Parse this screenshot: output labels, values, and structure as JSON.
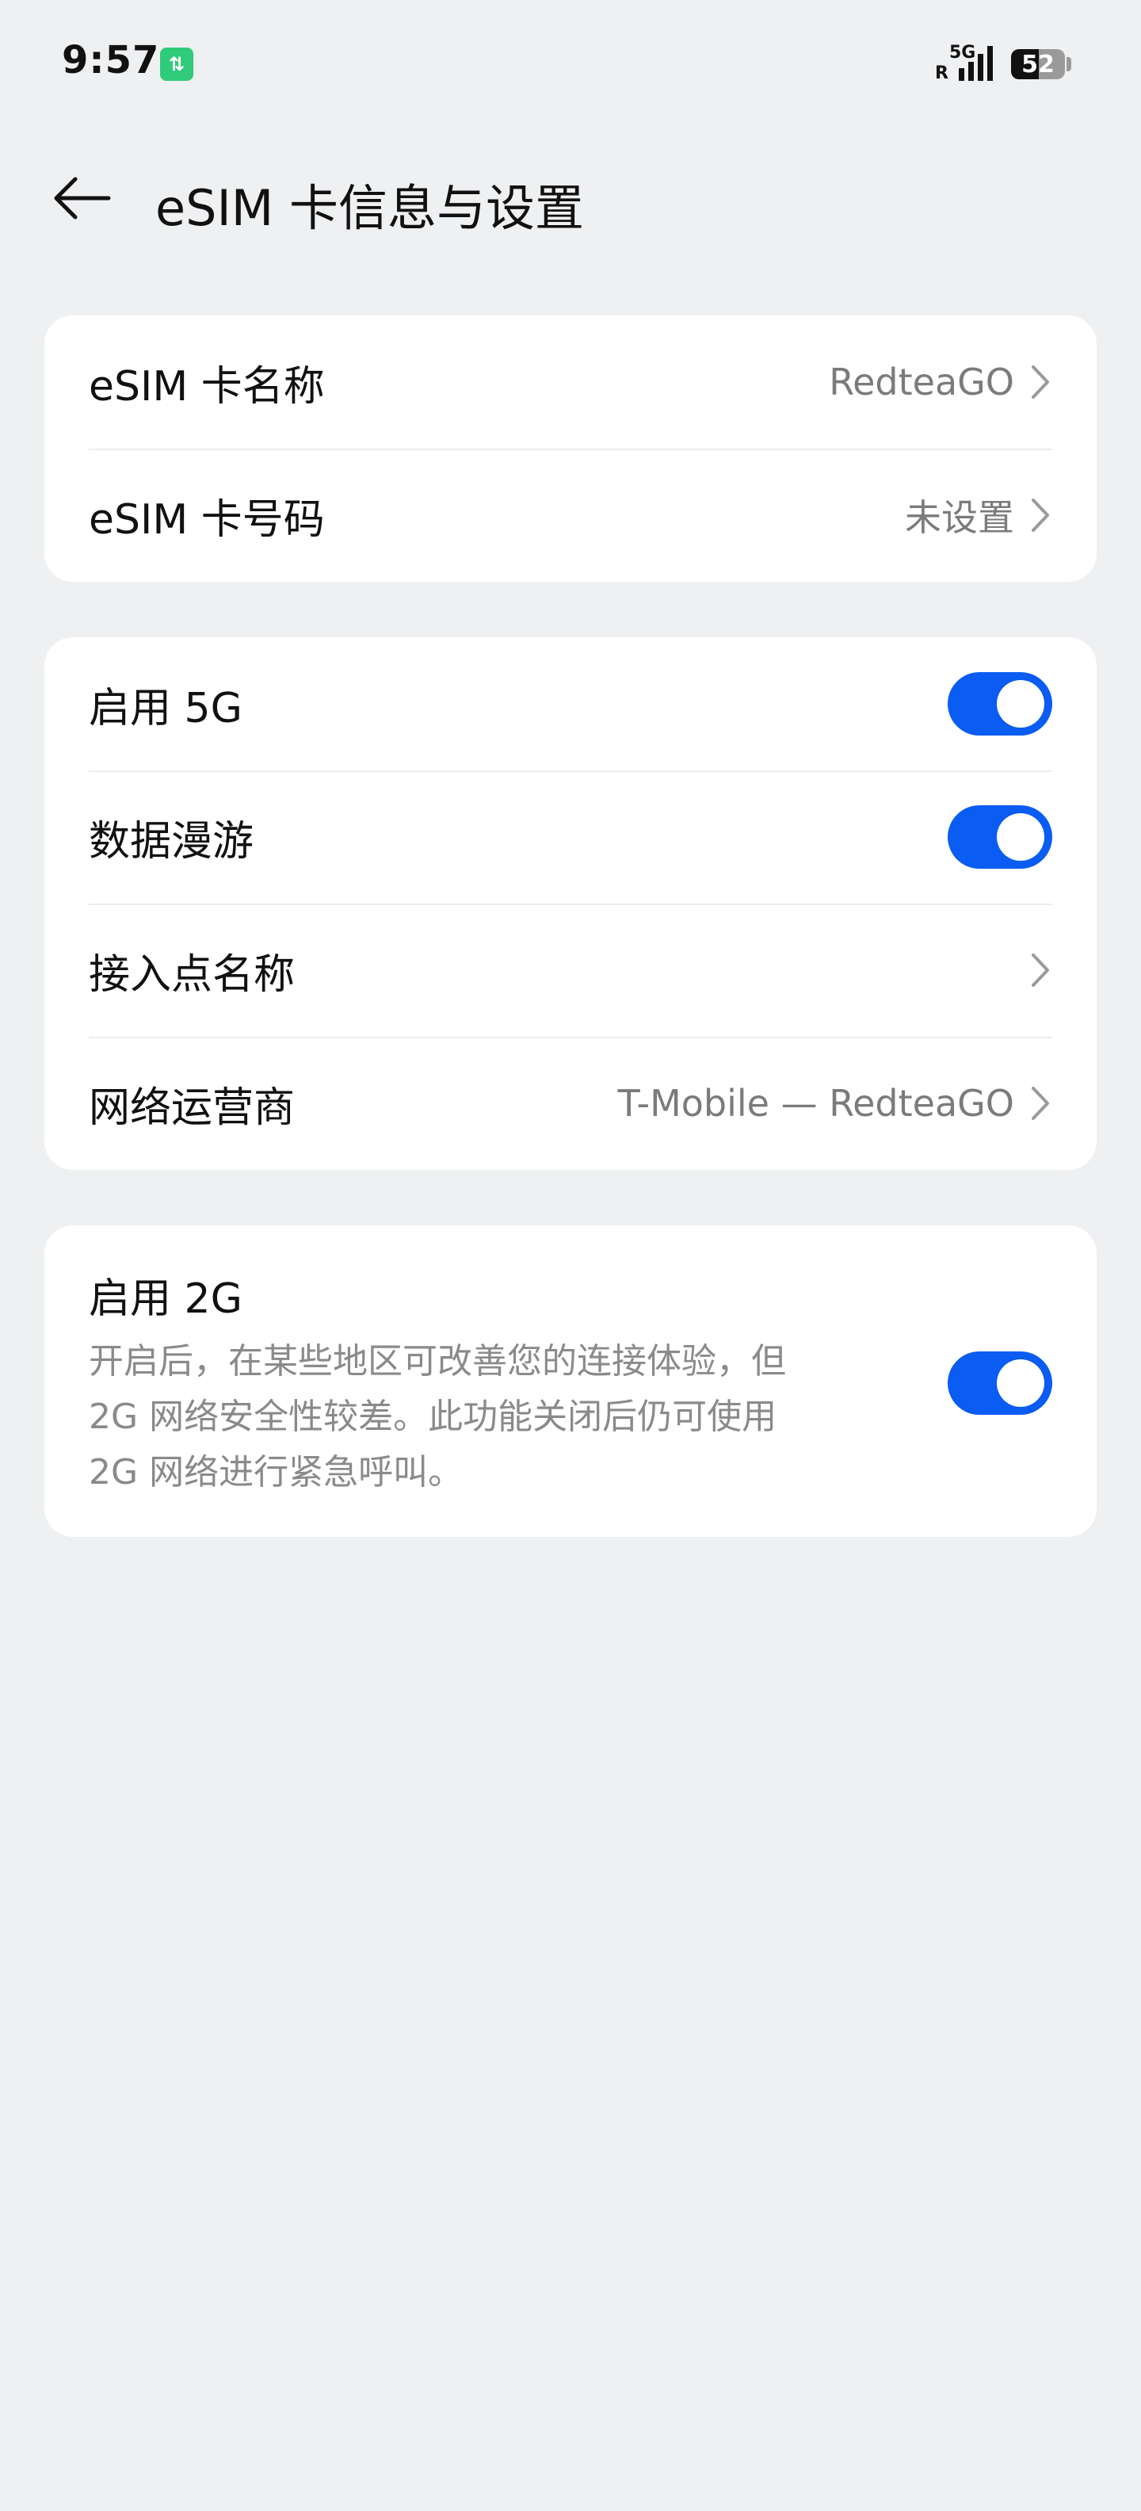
{
  "status_bar": {
    "time": "9:57",
    "data_badge": "⇅",
    "network_type": "5G",
    "roaming": "R",
    "battery_level": "52",
    "battery_fraction": 0.52
  },
  "header": {
    "title": "eSIM 卡信息与设置"
  },
  "card_info": {
    "name_label": "eSIM 卡名称",
    "name_value": "RedteaGO",
    "number_label": "eSIM 卡号码",
    "number_value": "未设置"
  },
  "card_network": {
    "enable_5g_label": "启用 5G",
    "enable_5g_on": true,
    "data_roaming_label": "数据漫游",
    "data_roaming_on": true,
    "apn_label": "接入点名称",
    "carrier_label": "网络运营商",
    "carrier_value": "T-Mobile — RedteaGO"
  },
  "card_2g": {
    "title": "启用 2G",
    "desc_line1": "开启后，在某些地区可改善您的连接体验，但",
    "desc_line2": "2G 网络安全性较差。此功能关闭后仍可使用",
    "desc_line3": "2G 网络进行紧急呼叫。",
    "enabled": true
  },
  "colors": {
    "accent": "#0a5cf2",
    "background": "#eff0f2",
    "card": "#ffffff",
    "secondary_text": "#7b7b7b"
  }
}
